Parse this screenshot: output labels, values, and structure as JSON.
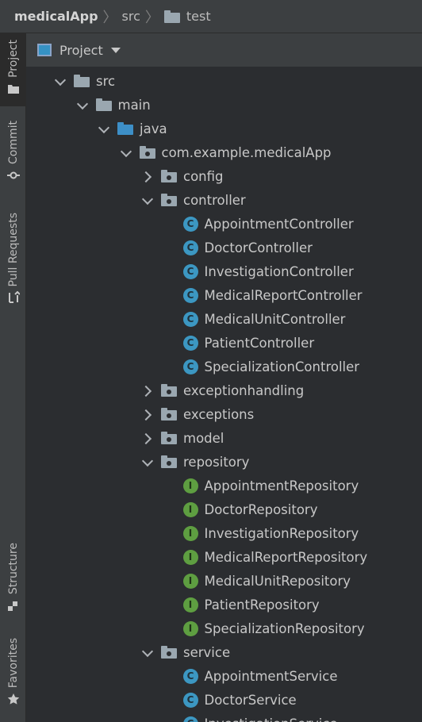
{
  "breadcrumb": {
    "app": "medicalApp",
    "src": "src",
    "test": "test"
  },
  "stripe": {
    "project": "Project",
    "commit": "Commit",
    "pull_requests": "Pull Requests",
    "structure": "Structure",
    "favorites": "Favorites"
  },
  "panel": {
    "title": "Project"
  },
  "tree": [
    {
      "label": "src",
      "level": 0,
      "expander": "down",
      "icon": "folder-gray"
    },
    {
      "label": "main",
      "level": 1,
      "expander": "down",
      "icon": "folder-gray"
    },
    {
      "label": "java",
      "level": 2,
      "expander": "down",
      "icon": "folder-blue"
    },
    {
      "label": "com.example.medicalApp",
      "level": 3,
      "expander": "down",
      "icon": "package"
    },
    {
      "label": "config",
      "level": 4,
      "expander": "right",
      "icon": "package"
    },
    {
      "label": "controller",
      "level": 4,
      "expander": "down",
      "icon": "package"
    },
    {
      "label": "AppointmentController",
      "level": 5,
      "expander": "none",
      "icon": "class"
    },
    {
      "label": "DoctorController",
      "level": 5,
      "expander": "none",
      "icon": "class"
    },
    {
      "label": "InvestigationController",
      "level": 5,
      "expander": "none",
      "icon": "class"
    },
    {
      "label": "MedicalReportController",
      "level": 5,
      "expander": "none",
      "icon": "class"
    },
    {
      "label": "MedicalUnitController",
      "level": 5,
      "expander": "none",
      "icon": "class"
    },
    {
      "label": "PatientController",
      "level": 5,
      "expander": "none",
      "icon": "class"
    },
    {
      "label": "SpecializationController",
      "level": 5,
      "expander": "none",
      "icon": "class"
    },
    {
      "label": "exceptionhandling",
      "level": 4,
      "expander": "right",
      "icon": "package"
    },
    {
      "label": "exceptions",
      "level": 4,
      "expander": "right",
      "icon": "package"
    },
    {
      "label": "model",
      "level": 4,
      "expander": "right",
      "icon": "package"
    },
    {
      "label": "repository",
      "level": 4,
      "expander": "down",
      "icon": "package"
    },
    {
      "label": "AppointmentRepository",
      "level": 5,
      "expander": "none",
      "icon": "interface"
    },
    {
      "label": "DoctorRepository",
      "level": 5,
      "expander": "none",
      "icon": "interface"
    },
    {
      "label": "InvestigationRepository",
      "level": 5,
      "expander": "none",
      "icon": "interface"
    },
    {
      "label": "MedicalReportRepository",
      "level": 5,
      "expander": "none",
      "icon": "interface"
    },
    {
      "label": "MedicalUnitRepository",
      "level": 5,
      "expander": "none",
      "icon": "interface"
    },
    {
      "label": "PatientRepository",
      "level": 5,
      "expander": "none",
      "icon": "interface"
    },
    {
      "label": "SpecializationRepository",
      "level": 5,
      "expander": "none",
      "icon": "interface"
    },
    {
      "label": "service",
      "level": 4,
      "expander": "down",
      "icon": "package"
    },
    {
      "label": "AppointmentService",
      "level": 5,
      "expander": "none",
      "icon": "class"
    },
    {
      "label": "DoctorService",
      "level": 5,
      "expander": "none",
      "icon": "class"
    },
    {
      "label": "InvestigationService",
      "level": 5,
      "expander": "none",
      "icon": "class"
    }
  ],
  "icon_glyphs": {
    "class": "C",
    "interface": "I"
  },
  "colors": {
    "background": "#2b2d30",
    "toolbar": "#3c3f41",
    "class_icon": "#3c97c2",
    "interface_icon": "#5e9e41",
    "java_folder": "#3d8fc7",
    "folder": "#9aa7b0"
  }
}
